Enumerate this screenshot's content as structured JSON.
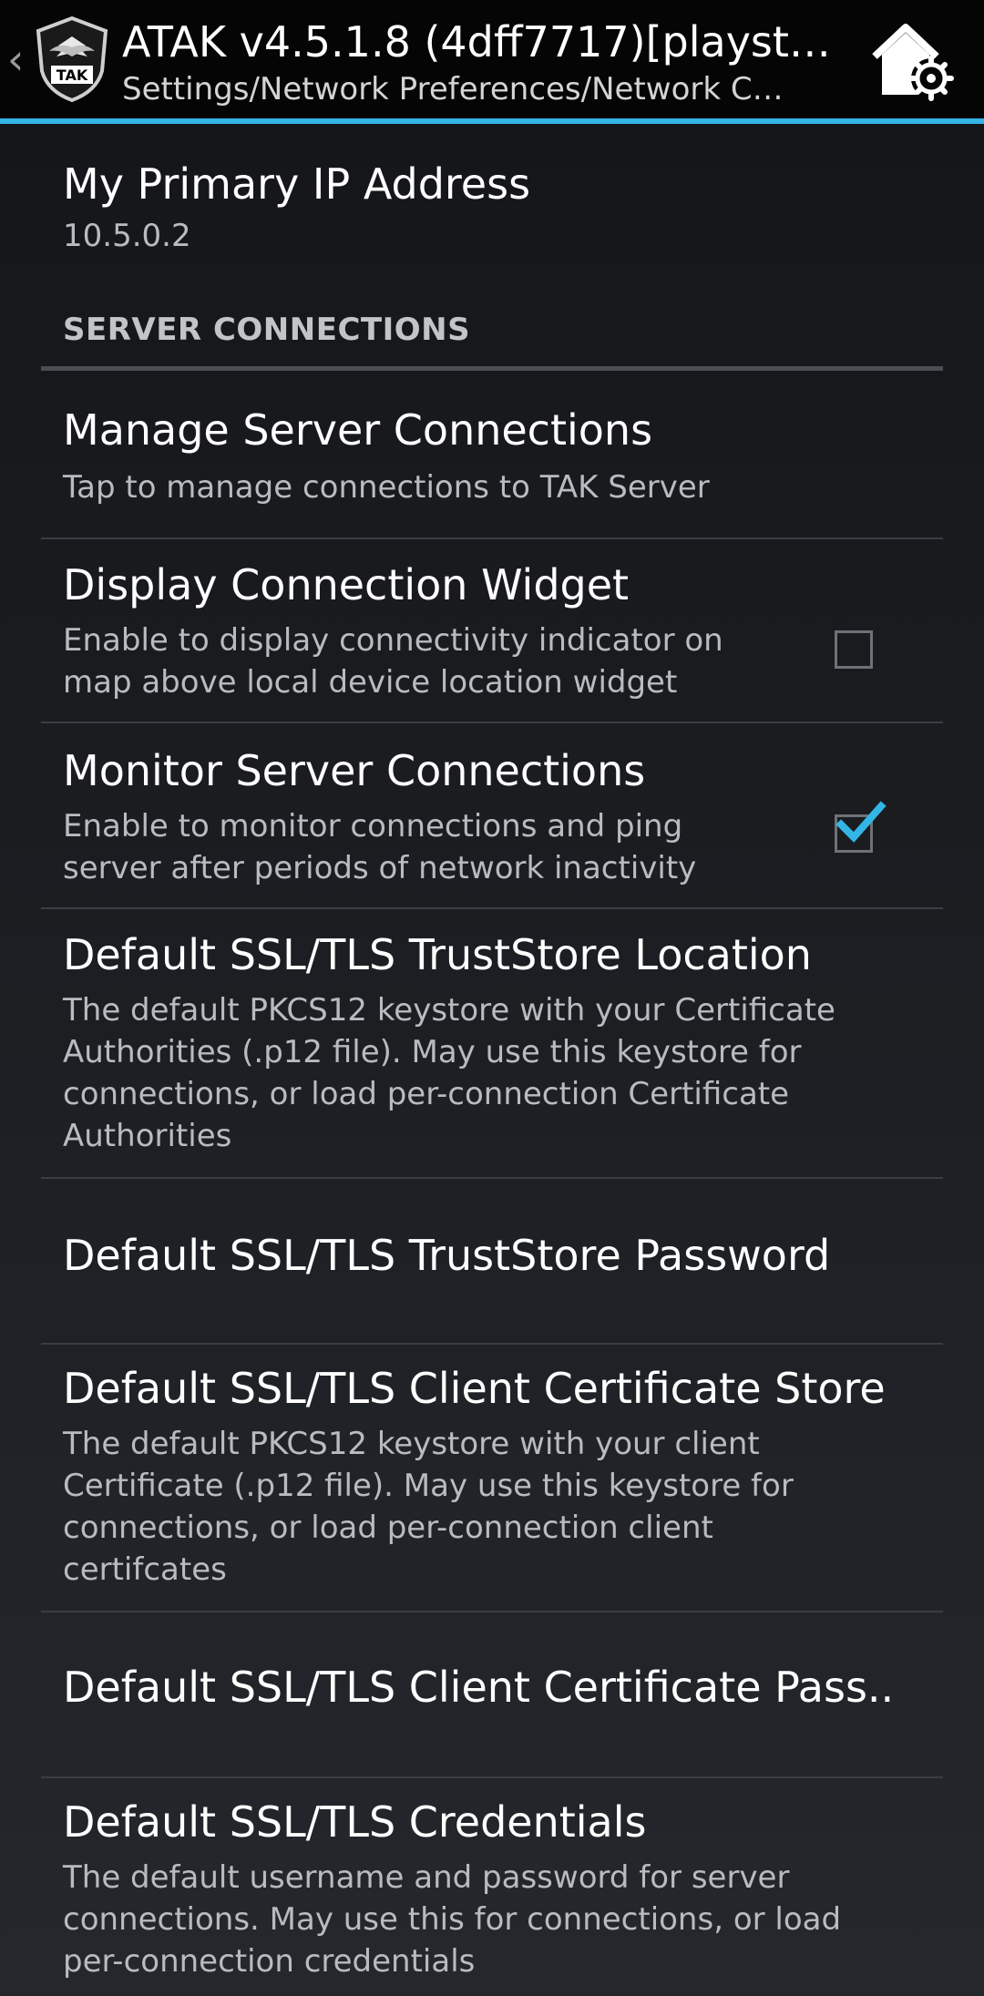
{
  "action_bar": {
    "title": "ATAK v4.5.1.8 (4dff7717)[playst…",
    "subtitle": "Settings/Network Preferences/Network C…",
    "logo_text": "TAK",
    "back_icon": "chevron-left-icon",
    "home_settings_icon": "home-gear-icon"
  },
  "primary_ip": {
    "title": "My Primary IP Address",
    "value": "10.5.0.2"
  },
  "category": {
    "label": "SERVER CONNECTIONS"
  },
  "preferences": [
    {
      "title": "Manage Server Connections",
      "summary": "Tap to manage connections to TAK Server"
    },
    {
      "title": "Display Connection Widget",
      "summary": "Enable to display connectivity indicator on map above local device location widget",
      "checked": false
    },
    {
      "title": "Monitor Server Connections",
      "summary": "Enable to monitor connections and ping server after periods of network inactivity",
      "checked": true
    },
    {
      "title": "Default SSL/TLS TrustStore Location",
      "summary": "The default PKCS12 keystore with your Certificate Authorities (.p12 file). May use this keystore for connections, or load per-connection Certificate Authorities"
    },
    {
      "title": "Default SSL/TLS TrustStore Password"
    },
    {
      "title": "Default SSL/TLS Client Certificate Store",
      "summary": "The default PKCS12 keystore with your client Certificate (.p12 file). May use this keystore for connections, or load per-connection client certifcates"
    },
    {
      "title": "Default SSL/TLS Client Certificate Pass.."
    },
    {
      "title": "Default SSL/TLS Credentials",
      "summary": "The default username and password for server connections. May use this for connections, or load per-connection credentials"
    }
  ],
  "colors": {
    "accent": "#33b5e5",
    "background": "#1b1d21",
    "action_bar": "#050505"
  }
}
